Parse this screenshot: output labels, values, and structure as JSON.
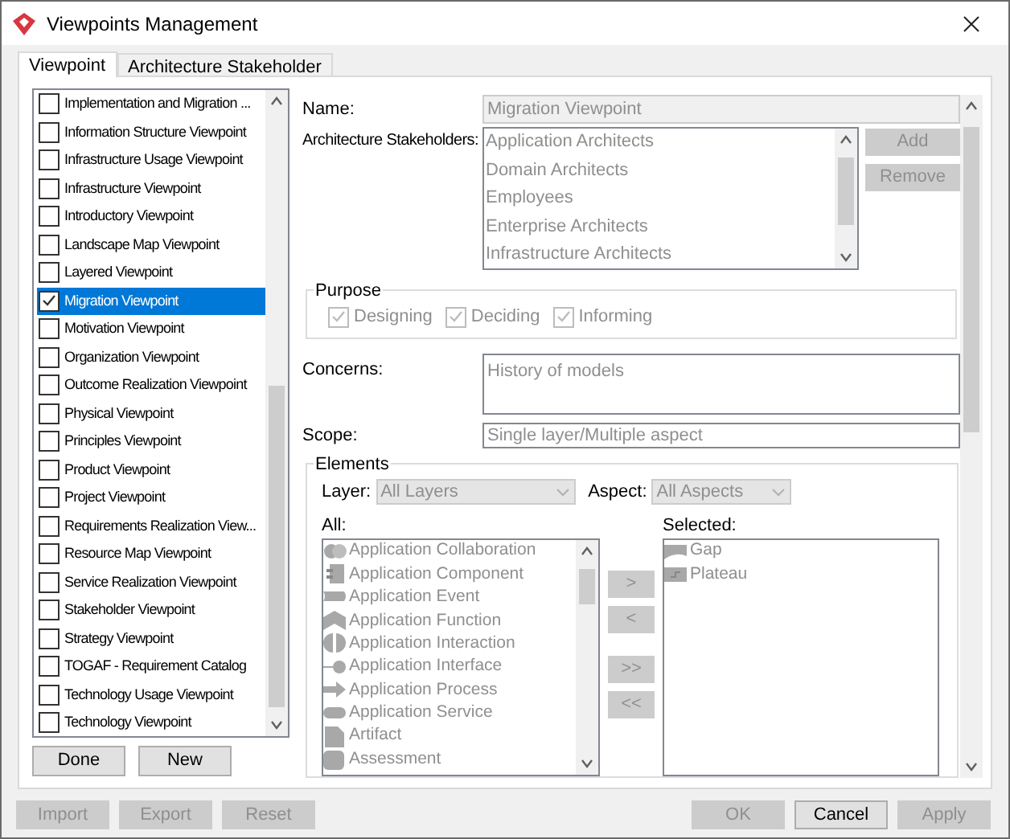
{
  "window": {
    "title": "Viewpoints Management"
  },
  "tabs": [
    {
      "label": "Viewpoint",
      "selected": true
    },
    {
      "label": "Architecture Stakeholder",
      "selected": false
    }
  ],
  "viewpoints": [
    {
      "label": "Implementation and Migration ...",
      "checked": false,
      "selected": false
    },
    {
      "label": "Information Structure Viewpoint",
      "checked": false,
      "selected": false
    },
    {
      "label": "Infrastructure Usage Viewpoint",
      "checked": false,
      "selected": false
    },
    {
      "label": "Infrastructure Viewpoint",
      "checked": false,
      "selected": false
    },
    {
      "label": "Introductory Viewpoint",
      "checked": false,
      "selected": false
    },
    {
      "label": "Landscape Map Viewpoint",
      "checked": false,
      "selected": false
    },
    {
      "label": "Layered Viewpoint",
      "checked": false,
      "selected": false
    },
    {
      "label": "Migration Viewpoint",
      "checked": true,
      "selected": true
    },
    {
      "label": "Motivation Viewpoint",
      "checked": false,
      "selected": false
    },
    {
      "label": "Organization Viewpoint",
      "checked": false,
      "selected": false
    },
    {
      "label": "Outcome Realization Viewpoint",
      "checked": false,
      "selected": false
    },
    {
      "label": "Physical Viewpoint",
      "checked": false,
      "selected": false
    },
    {
      "label": "Principles Viewpoint",
      "checked": false,
      "selected": false
    },
    {
      "label": "Product Viewpoint",
      "checked": false,
      "selected": false
    },
    {
      "label": "Project Viewpoint",
      "checked": false,
      "selected": false
    },
    {
      "label": "Requirements Realization View...",
      "checked": false,
      "selected": false
    },
    {
      "label": "Resource Map Viewpoint",
      "checked": false,
      "selected": false
    },
    {
      "label": "Service Realization Viewpoint",
      "checked": false,
      "selected": false
    },
    {
      "label": "Stakeholder Viewpoint",
      "checked": false,
      "selected": false
    },
    {
      "label": "Strategy Viewpoint",
      "checked": false,
      "selected": false
    },
    {
      "label": "TOGAF - Requirement Catalog",
      "checked": false,
      "selected": false
    },
    {
      "label": "Technology Usage Viewpoint",
      "checked": false,
      "selected": false
    },
    {
      "label": "Technology Viewpoint",
      "checked": false,
      "selected": false
    }
  ],
  "list_buttons": [
    {
      "label": "Done",
      "disabled": false
    },
    {
      "label": "New",
      "disabled": false
    }
  ],
  "form": {
    "name_label": "Name:",
    "name_value": "Migration Viewpoint",
    "stakeholders_label": "Architecture Stakeholders:",
    "stakeholders": [
      "Application Architects",
      "Domain Architects",
      "Employees",
      "Enterprise Architects",
      "Infrastructure Architects"
    ],
    "stakeholder_buttons": [
      {
        "label": "Add",
        "disabled": true
      },
      {
        "label": "Remove",
        "disabled": true
      }
    ],
    "purpose": {
      "title": "Purpose",
      "options": [
        {
          "label": "Designing",
          "checked": true,
          "disabled": true
        },
        {
          "label": "Deciding",
          "checked": true,
          "disabled": true
        },
        {
          "label": "Informing",
          "checked": true,
          "disabled": true
        }
      ]
    },
    "concerns_label": "Concerns:",
    "concerns_value": "History of models",
    "scope_label": "Scope:",
    "scope_value": "Single layer/Multiple aspect"
  },
  "elements": {
    "title": "Elements",
    "layer_label": "Layer:",
    "layer_value": "All Layers",
    "aspect_label": "Aspect:",
    "aspect_value": "All Aspects",
    "all_label": "All:",
    "selected_label": "Selected:",
    "all": [
      {
        "label": "Application Collaboration",
        "kind": "collaboration"
      },
      {
        "label": "Application Component",
        "kind": "component"
      },
      {
        "label": "Application Event",
        "kind": "event"
      },
      {
        "label": "Application Function",
        "kind": "function"
      },
      {
        "label": "Application Interaction",
        "kind": "interaction"
      },
      {
        "label": "Application Interface",
        "kind": "interface"
      },
      {
        "label": "Application Process",
        "kind": "process"
      },
      {
        "label": "Application Service",
        "kind": "service"
      },
      {
        "label": "Artifact",
        "kind": "artifact"
      },
      {
        "label": "Assessment",
        "kind": "assessment"
      }
    ],
    "selected": [
      {
        "label": "Gap",
        "kind": "gap"
      },
      {
        "label": "Plateau",
        "kind": "plateau"
      }
    ],
    "move_buttons": [
      {
        "label": ">",
        "disabled": true
      },
      {
        "label": "<",
        "disabled": true
      },
      {
        "label": ">>",
        "disabled": true
      },
      {
        "label": "<<",
        "disabled": true
      }
    ]
  },
  "footer_left": [
    {
      "label": "Import",
      "disabled": true
    },
    {
      "label": "Export",
      "disabled": true
    },
    {
      "label": "Reset",
      "disabled": true
    }
  ],
  "footer_right": [
    {
      "label": "OK",
      "disabled": true
    },
    {
      "label": "Cancel",
      "disabled": false
    },
    {
      "label": "Apply",
      "disabled": true
    }
  ]
}
